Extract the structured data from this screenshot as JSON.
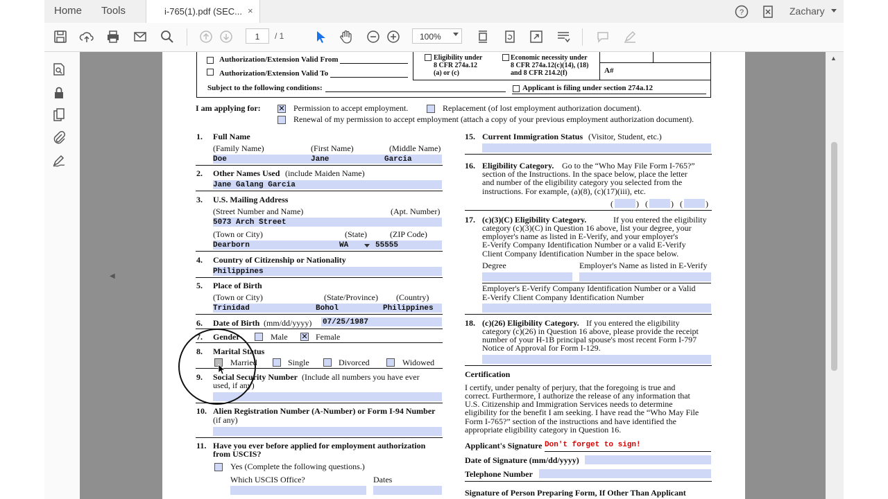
{
  "tabbar": {
    "home": "Home",
    "tools": "Tools",
    "tab_title": "i-765(1).pdf (SEC...",
    "close": "×",
    "user": "Zachary"
  },
  "toolbar": {
    "page_current": "1",
    "page_total": "/ 1",
    "zoom": "100%"
  },
  "form": {
    "top": {
      "auth_from": "Authorization/Extension Valid From",
      "auth_to": "Authorization/Extension Valid To",
      "conditions": "Subject to the following conditions:",
      "elig1": "Eligibility under",
      "elig2": "8 CFR 274a.12",
      "elig3": "(a) or (c)",
      "econ1": "Economic necessity under",
      "econ2": "8 CFR 274a.12(c)(14), (18)",
      "econ3": "and 8 CFR 214.2(f)",
      "anum": "A#",
      "filing": "Applicant is filing under section 274a.12"
    },
    "applying": {
      "label": "I am applying for:",
      "opt1": "Permission to accept employment.",
      "opt2": "Replacement (of lost employment authorization document).",
      "opt3": "Renewal of my permission to accept employment (attach a copy of your previous employment authorization document)."
    },
    "q1": {
      "num": "1.",
      "label": "Full Name",
      "family": "(Family Name)",
      "first": "(First Name)",
      "middle": "(Middle Name)",
      "v_family": "Doe",
      "v_first": "Jane",
      "v_middle": "Garcia"
    },
    "q2": {
      "num": "2.",
      "label": "Other Names Used",
      "sub": "(include Maiden Name)",
      "value": "Jane Galang Garcia"
    },
    "q3": {
      "num": "3.",
      "label": "U.S. Mailing Address",
      "street": "(Street Number and Name)",
      "apt": "(Apt. Number)",
      "v_street": "5073 Arch Street",
      "town": "(Town or City)",
      "state": "(State)",
      "zip": "(ZIP Code)",
      "v_town": "Dearborn",
      "v_state": "WA",
      "v_zip": "55555"
    },
    "q4": {
      "num": "4.",
      "label": "Country of Citizenship or Nationality",
      "value": "Philippines"
    },
    "q5": {
      "num": "5.",
      "label": "Place of Birth",
      "town": "(Town or City)",
      "state": "(State/Province)",
      "country": "(Country)",
      "v_town": "Trinidad",
      "v_state": "Bohol",
      "v_country": "Philippines"
    },
    "q6": {
      "num": "6.",
      "label": "Date of Birth",
      "sub": "(mm/dd/yyyy)",
      "value": "07/25/1987"
    },
    "q7": {
      "num": "7.",
      "label": "Gender",
      "male": "Male",
      "female": "Female"
    },
    "q8": {
      "num": "8.",
      "label": "Marital Status",
      "married": "Married",
      "single": "Single",
      "divorced": "Divorced",
      "widowed": "Widowed"
    },
    "q9": {
      "num": "9.",
      "label": "Social Security Number",
      "sub": "(Include all numbers you have ever",
      "sub2": "used, if any)"
    },
    "q10": {
      "num": "10.",
      "label": "Alien Registration Number (A-Number) or Form I-94 Number",
      "sub": "(if any)"
    },
    "q11": {
      "num": "11.",
      "label": "Have you ever before applied for employment authorization",
      "label2": "from USCIS?",
      "yes": "Yes (Complete the following questions.)",
      "office": "Which USCIS Office?",
      "dates": "Dates"
    },
    "q15": {
      "num": "15.",
      "label": "Current Immigration Status",
      "sub": "(Visitor, Student, etc.)"
    },
    "q16": {
      "num": "16.",
      "label": "Eligibility Category.",
      "t1": "Go to the “Who May File Form I-765?”",
      "t2": "section of the Instructions.  In the space below, place the letter",
      "t3": "and number of the eligibility category you selected from the",
      "t4": "instructions.  For example, (a)(8), (c)(17)(iii), etc."
    },
    "q17": {
      "num": "17.",
      "label": "(c)(3)(C) Eligibility Category.",
      "t1": "If you entered the eligibility",
      "t2": "category (c)(3)(C) in Question 16 above, list your degree, your",
      "t3": "employer's name as listed in E-Verify, and your employer's",
      "t4": "E-Verify Company Identification Number or a valid E-Verify",
      "t5": "Client Company Identification Number in the space below.",
      "degree": "Degree",
      "employer": "Employer's Name as listed in E-Verify",
      "t6": "Employer's E-Verify Company Identification Number or a Valid",
      "t7": "E-Verify Client Company Identification Number"
    },
    "q18": {
      "num": "18.",
      "label": "(c)(26) Eligibility Category.",
      "t1": "If you entered the eligibility",
      "t2": "category (c)(26) in Question 16 above, please provide the receipt",
      "t3": "number of your H-1B principal spouse's most recent Form I-797",
      "t4": "Notice of Approval for Form I-129."
    },
    "cert": {
      "title": "Certification",
      "t1": "I certify, under penalty of perjury, that the foregoing is true and",
      "t2": "correct.  Furthermore, I authorize the release of any information that",
      "t3": "U.S. Citizenship and Immigration Services needs to determine",
      "t4": "eligibility for the benefit I am seeking.  I have read the “Who May File",
      "t5": "Form I-765?” section of the instructions and have identified the",
      "t6": "appropriate eligibility category in Question 16.",
      "sig_label": "Applicant's Signature",
      "sig_value": "Don't forget to sign!",
      "date_label": "Date of Signature (mm/dd/yyyy)",
      "phone_label": "Telephone Number",
      "preparer": "Signature of Person Preparing Form, If Other Than Applicant"
    }
  },
  "colors": {
    "field": "#cfd8f7",
    "viewer_bg": "#8f8f8f",
    "accent": "#1a73e8"
  }
}
